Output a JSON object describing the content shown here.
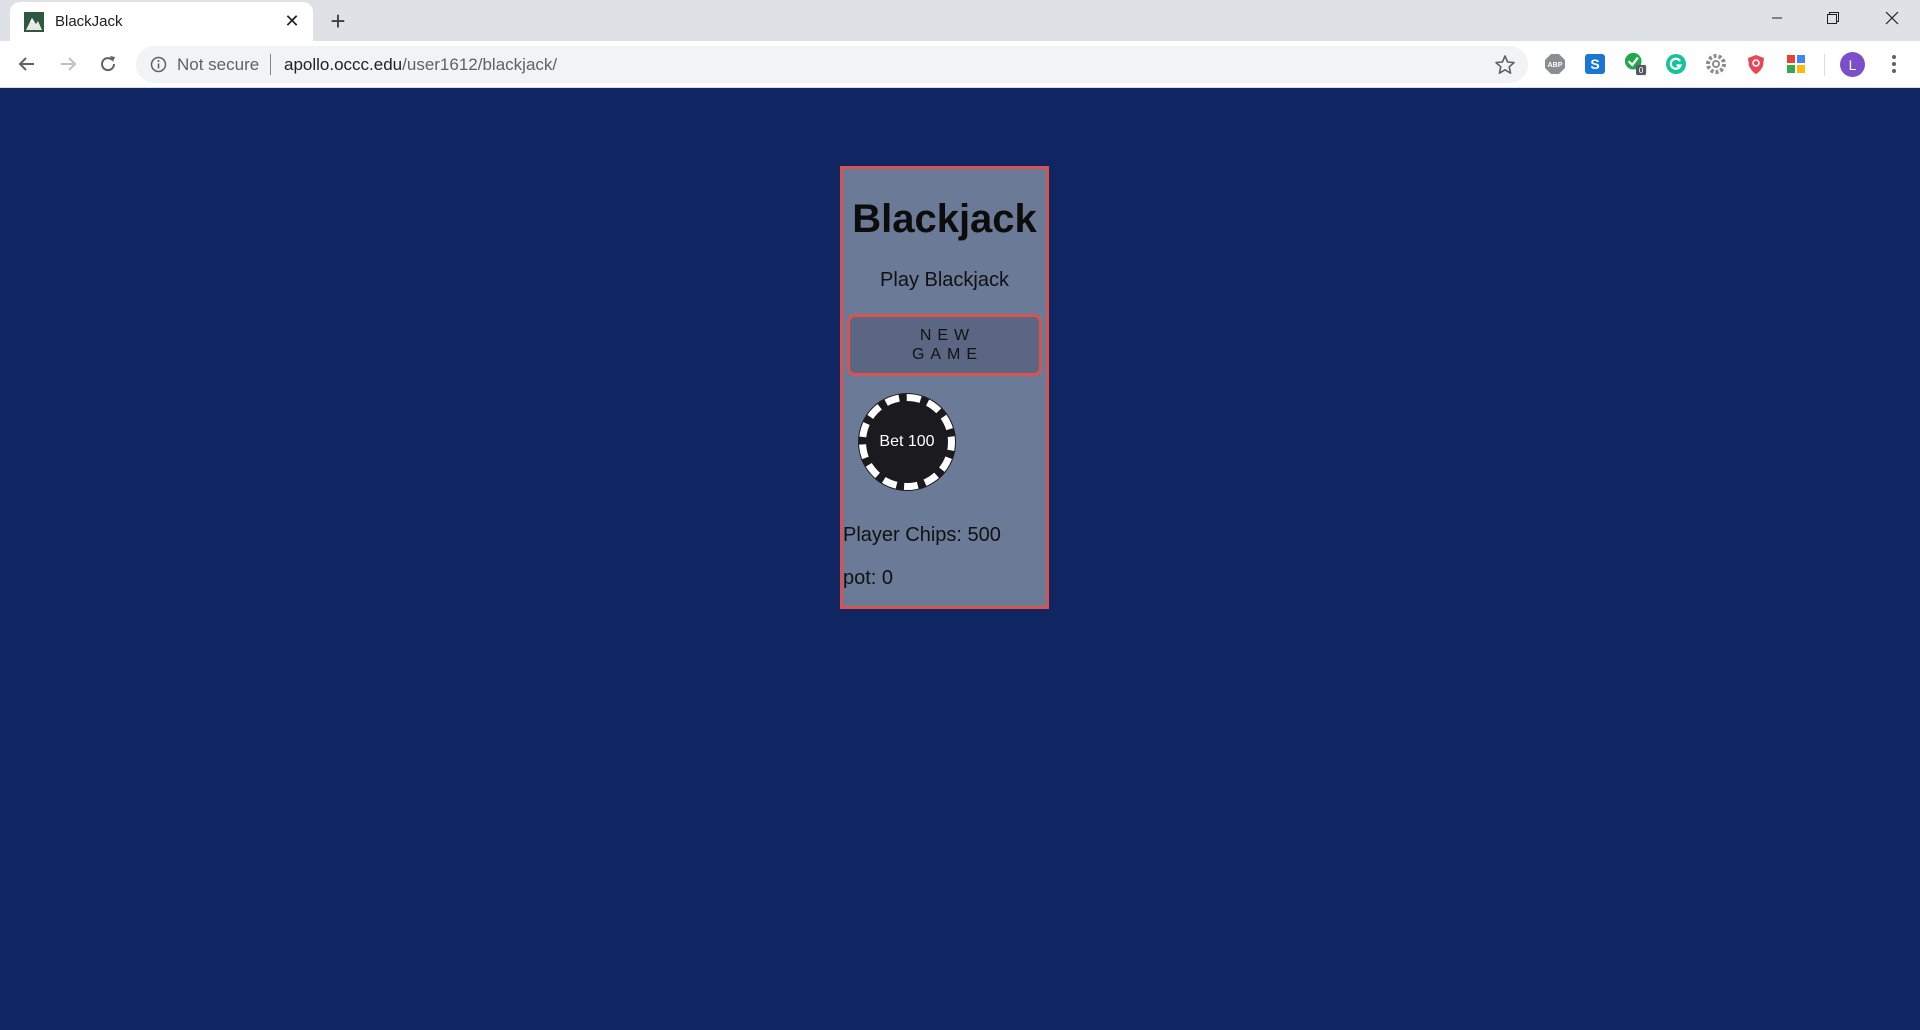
{
  "browser": {
    "tab": {
      "title": "BlackJack"
    },
    "address_bar": {
      "security_label": "Not secure",
      "url_domain": "apollo.occc.edu",
      "url_path": "/user1612/blackjack/"
    },
    "extensions": {
      "abp_label": "ABP",
      "badge_count": "0"
    },
    "profile_initial": "L"
  },
  "game": {
    "title": "Blackjack",
    "subtitle": "Play Blackjack",
    "new_game_label": "NEW GAME",
    "bet_chip_label": "Bet 100",
    "player_chips_text": "Player Chips: 500",
    "pot_text": "pot: 0"
  },
  "colors": {
    "page_background": "#0f2662",
    "panel_background": "#6b7a96",
    "panel_border": "#d9534f",
    "button_background": "#5a6682",
    "chip_background": "#1a1a1f"
  }
}
